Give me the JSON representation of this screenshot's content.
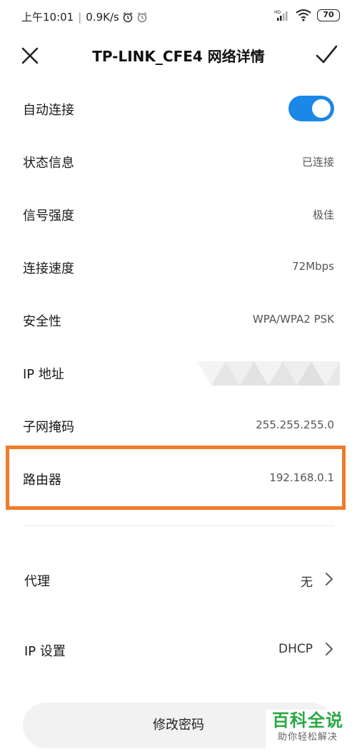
{
  "status_bar": {
    "time": "上午10:01",
    "speed": "0.9K/s",
    "battery": "70",
    "alarm_icon": "alarm-clock-icon",
    "clock_icon": "clock-icon",
    "signal_icon": "signal-hd-icon",
    "wifi_icon": "wifi-icon",
    "battery_icon": "battery-icon"
  },
  "header": {
    "title": "TP-LINK_CFE4 网络详情",
    "close_icon": "close-icon",
    "confirm_icon": "check-icon"
  },
  "rows": [
    {
      "label": "自动连接",
      "toggle_on": true
    },
    {
      "label": "状态信息",
      "value": "已连接"
    },
    {
      "label": "信号强度",
      "value": "极佳"
    },
    {
      "label": "连接速度",
      "value": "72Mbps"
    },
    {
      "label": "安全性",
      "value": "WPA/WPA2 PSK"
    },
    {
      "label": "IP 地址"
    },
    {
      "label": "子网掩码",
      "value": "255.255.255.0"
    },
    {
      "label": "路由器",
      "value": "192.168.0.1"
    }
  ],
  "nav_rows": [
    {
      "label": "代理",
      "value": "无"
    },
    {
      "label": "IP 设置",
      "value": "DHCP"
    }
  ],
  "password_button": "修改密码",
  "watermark": {
    "title": "百科全说",
    "subtitle": "助你轻松解决"
  },
  "colors": {
    "accent": "#1b87e6",
    "highlight": "#f07b2a",
    "watermark": "#2aa845"
  }
}
